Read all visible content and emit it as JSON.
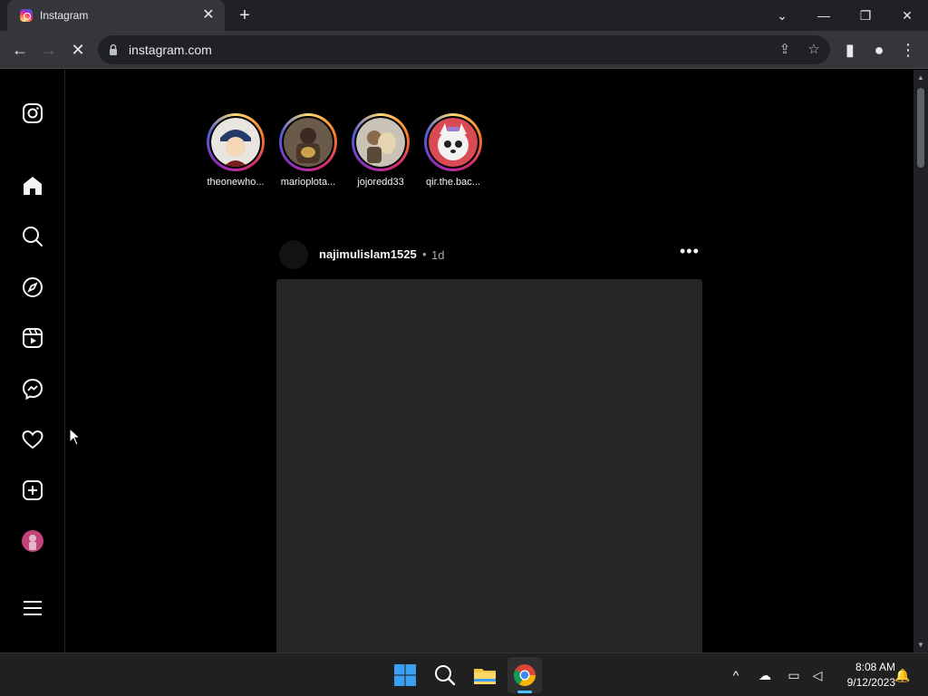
{
  "browser": {
    "tab_title": "Instagram",
    "url": "instagram.com"
  },
  "sidebar": {
    "items": [
      {
        "name": "instagram-logo-icon"
      },
      {
        "name": "home-icon"
      },
      {
        "name": "search-icon"
      },
      {
        "name": "explore-icon"
      },
      {
        "name": "reels-icon"
      },
      {
        "name": "messenger-icon"
      },
      {
        "name": "notifications-heart-icon"
      },
      {
        "name": "create-icon"
      },
      {
        "name": "profile-avatar"
      },
      {
        "name": "more-menu-icon"
      }
    ]
  },
  "stories": [
    {
      "username": "theonewho..."
    },
    {
      "username": "marioplota..."
    },
    {
      "username": "jojoredd33"
    },
    {
      "username": "qir.the.bac..."
    }
  ],
  "post": {
    "username": "najimulislam1525",
    "separator": "•",
    "time": "1d",
    "more": "•••"
  },
  "taskbar": {
    "time": "8:08 AM",
    "date": "9/12/2023"
  },
  "colors": {
    "background": "#000000",
    "chrome_toolbar": "#35363a",
    "accent_blue": "#4cc2ff"
  }
}
